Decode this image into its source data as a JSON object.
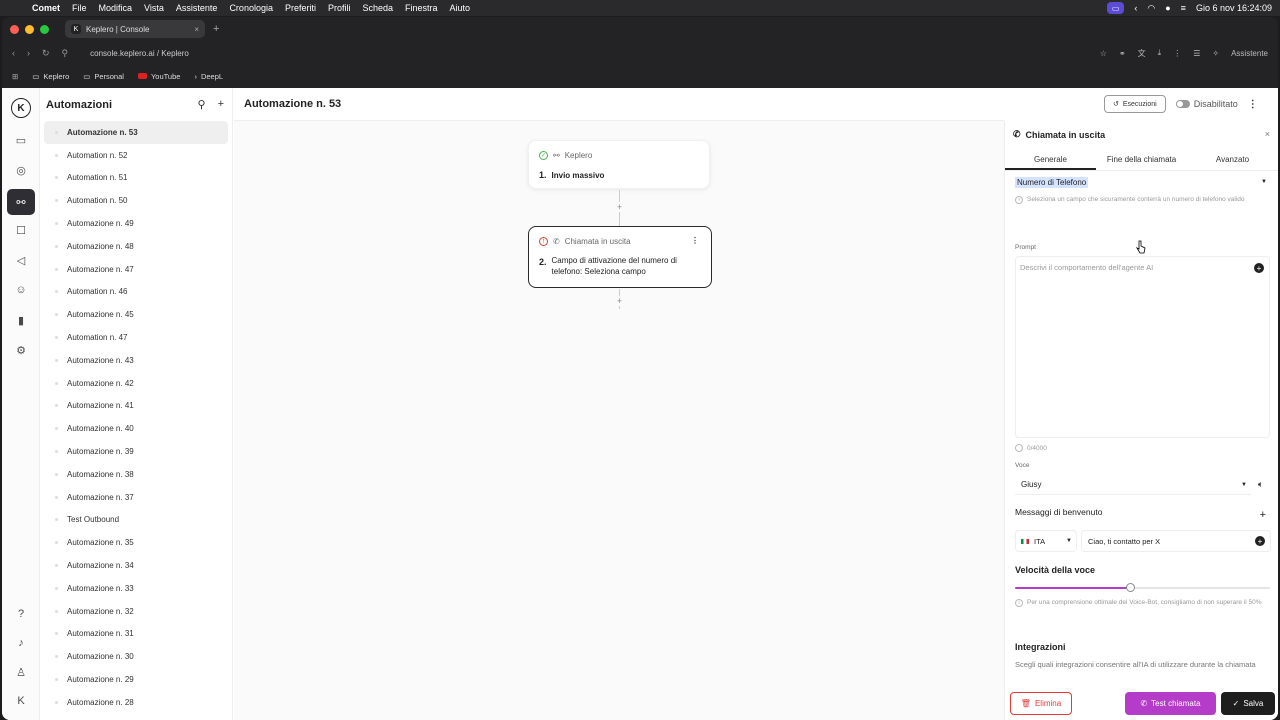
{
  "menubar": {
    "app": "Comet",
    "items": [
      "File",
      "Modifica",
      "Vista",
      "Assistente",
      "Cronologia",
      "Preferiti",
      "Profili",
      "Scheda",
      "Finestra",
      "Aiuto"
    ],
    "datetime": "Gio 6 nov  16:24:09"
  },
  "browser": {
    "tab_title": "Keplero | Console",
    "url": "console.keplero.ai / Keplero",
    "assistant_label": "Assistente",
    "bookmarks": [
      "Keplero",
      "Personal",
      "YouTube",
      "DeepL"
    ]
  },
  "sidebar": {
    "title": "Automazioni",
    "items": [
      "Automazione n. 53",
      "Automation n. 52",
      "Automation n. 51",
      "Automation n. 50",
      "Automazione n. 49",
      "Automazione n. 48",
      "Automazione n. 47",
      "Automation n. 46",
      "Automazione n. 45",
      "Automation n. 47",
      "Automazione n. 43",
      "Automazione n. 42",
      "Automazione n. 41",
      "Automazione n. 40",
      "Automazione n. 39",
      "Automazione n. 38",
      "Automazione n. 37",
      "Test Outbound",
      "Automazione n. 35",
      "Automazione n. 34",
      "Automazione n. 33",
      "Automazione n. 32",
      "Automazione n. 31",
      "Automazione n. 30",
      "Automazione n. 29",
      "Automazione n. 28"
    ]
  },
  "main": {
    "title": "Automazione n. 53",
    "exec_button": "Esecuzioni",
    "status": "Disabilitato",
    "node1": {
      "app": "Keplero",
      "number": "1.",
      "label": "Invio massivo"
    },
    "node2": {
      "app": "Chiamata in uscita",
      "number": "2.",
      "label": "Campo di attivazione del numero di telefono: Seleziona campo"
    }
  },
  "panel": {
    "title": "Chiamata in uscita",
    "tabs": [
      "Generale",
      "Fine della chiamata",
      "Avanzato"
    ],
    "phone_field": "Numero di Telefono",
    "phone_hint": "Seleziona un campo che sicuramente conterrà un numero di telefono valido",
    "prompt_label": "Prompt",
    "prompt_placeholder": "Descrivi il comportamento dell'agente AI",
    "counter": "0/4000",
    "voice_label": "Voce",
    "voice_value": "Giusy",
    "welcome_title": "Messaggi di benvenuto",
    "lang": "ITA",
    "welcome_msg": "Ciao, ti contatto per X",
    "speed_title": "Velocità della voce",
    "speed_value": 0.45,
    "speed_hint": "Per una comprensione ottimale del Voice-Bot, consigliamo di non superare il 50%",
    "integrations_title": "Integrazioni",
    "integrations_desc": "Scegli quali integrazioni consentire all'IA di utilizzare durante la chiamata",
    "btn_delete": "Elimina",
    "btn_test": "Test chiamata",
    "btn_save": "Salva"
  },
  "colors": {
    "accent": "#b43cc8",
    "danger": "#e53935",
    "dark": "#1e1e1e"
  }
}
